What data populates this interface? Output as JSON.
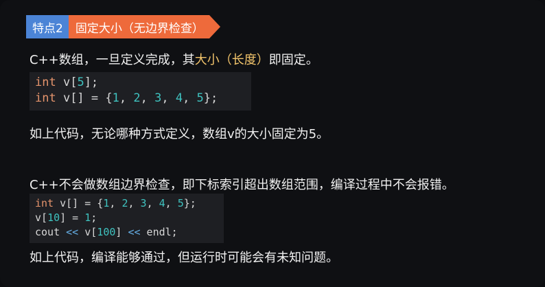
{
  "badge": {
    "number_label": "特点2",
    "title": "固定大小（无边界检查）",
    "colors": {
      "number_bg": "#4b84d6",
      "title_bg": "#ee6a3b"
    }
  },
  "section1": {
    "intro_pre": "C++数组，一旦定义完成，其",
    "intro_highlight": "大小（长度）",
    "intro_post": "即固定。",
    "code": [
      [
        {
          "t": "int",
          "k": "kw"
        },
        {
          "t": " v[",
          "k": "pl"
        },
        {
          "t": "5",
          "k": "num"
        },
        {
          "t": "];",
          "k": "pl"
        }
      ],
      [
        {
          "t": "int",
          "k": "kw"
        },
        {
          "t": " v[] = {",
          "k": "pl"
        },
        {
          "t": "1",
          "k": "num"
        },
        {
          "t": ", ",
          "k": "pl"
        },
        {
          "t": "2",
          "k": "num"
        },
        {
          "t": ", ",
          "k": "pl"
        },
        {
          "t": "3",
          "k": "num"
        },
        {
          "t": ", ",
          "k": "pl"
        },
        {
          "t": "4",
          "k": "num"
        },
        {
          "t": ", ",
          "k": "pl"
        },
        {
          "t": "5",
          "k": "num"
        },
        {
          "t": "};",
          "k": "pl"
        }
      ]
    ],
    "note": "如上代码，无论哪种方式定义，数组v的大小固定为5。"
  },
  "section2": {
    "intro": "C++不会做数组边界检查，即下标索引超出数组范围，编译过程中不会报错。",
    "code": [
      [
        {
          "t": "int",
          "k": "kw"
        },
        {
          "t": " v[] = {",
          "k": "pl"
        },
        {
          "t": "1",
          "k": "num"
        },
        {
          "t": ", ",
          "k": "pl"
        },
        {
          "t": "2",
          "k": "num"
        },
        {
          "t": ", ",
          "k": "pl"
        },
        {
          "t": "3",
          "k": "num"
        },
        {
          "t": ", ",
          "k": "pl"
        },
        {
          "t": "4",
          "k": "num"
        },
        {
          "t": ", ",
          "k": "pl"
        },
        {
          "t": "5",
          "k": "num"
        },
        {
          "t": "};",
          "k": "pl"
        }
      ],
      [
        {
          "t": "v[",
          "k": "pl"
        },
        {
          "t": "10",
          "k": "num"
        },
        {
          "t": "] = ",
          "k": "pl"
        },
        {
          "t": "1",
          "k": "num"
        },
        {
          "t": ";",
          "k": "pl"
        }
      ],
      [
        {
          "t": "cout ",
          "k": "pl"
        },
        {
          "t": "<<",
          "k": "op"
        },
        {
          "t": " v[",
          "k": "pl"
        },
        {
          "t": "100",
          "k": "num"
        },
        {
          "t": "] ",
          "k": "pl"
        },
        {
          "t": "<<",
          "k": "op"
        },
        {
          "t": " endl;",
          "k": "pl"
        }
      ]
    ],
    "note": "如上代码，编译能够通过，但运行时可能会有未知问题。"
  },
  "colors": {
    "background": "#0f1013",
    "text": "#f1f1f1",
    "highlight": "#f2c46b",
    "code_bg": "#1e1f23",
    "keyword": "#e5946c",
    "number": "#3fc3c0",
    "operator": "#66b0e8"
  }
}
